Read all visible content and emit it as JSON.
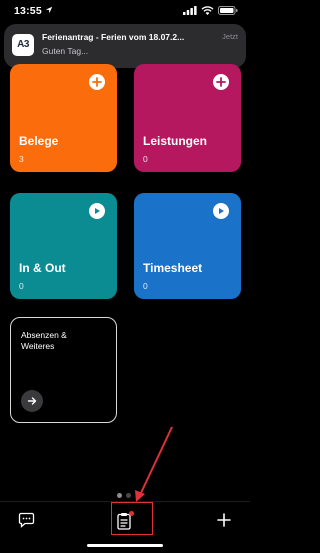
{
  "status": {
    "time": "13:55"
  },
  "notification": {
    "app_icon_text": "A3",
    "title": "Ferienantrag - Ferien vom 18.07.2...",
    "time": "Jetzt",
    "body": "Guten Tag..."
  },
  "tiles": [
    {
      "label": "Belege",
      "count": "3",
      "color": "#fb6d0c",
      "action": "plus-icon"
    },
    {
      "label": "Leistungen",
      "count": "0",
      "color": "#b5185e",
      "action": "plus-icon"
    },
    {
      "label": "In & Out",
      "count": "0",
      "color": "#0b8b92",
      "action": "play-icon"
    },
    {
      "label": "Timesheet",
      "count": "0",
      "color": "#1a73c9",
      "action": "play-icon"
    }
  ],
  "absences_tile": {
    "title": "Absenzen & Weiteres"
  },
  "tabbar": {
    "items": [
      "chat-icon",
      "clipboard-icon",
      "plus-icon"
    ],
    "active_index": 1,
    "badge_color": "#e0303a"
  },
  "page_indicator": {
    "count": 2,
    "current": 0
  },
  "annotation": {
    "color": "#e0303a"
  }
}
